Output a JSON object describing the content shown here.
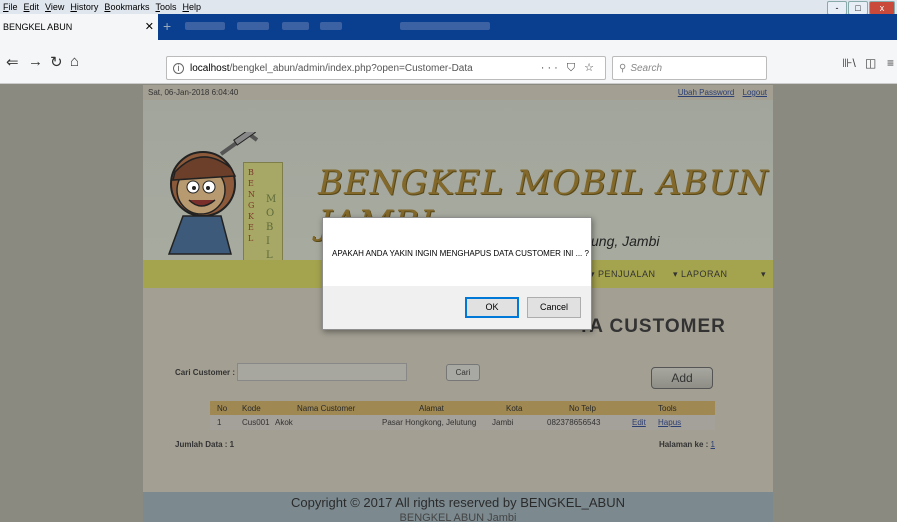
{
  "menubar": {
    "items": [
      "File",
      "Edit",
      "View",
      "History",
      "Bookmarks",
      "Tools",
      "Help"
    ],
    "window_controls": [
      "-",
      "□",
      "x"
    ]
  },
  "tab": {
    "title": "BENGKEL ABUN",
    "close": "✕",
    "new_tab": "+"
  },
  "nav": {
    "back": "⇐",
    "forward": "→",
    "reload": "↻",
    "home": "⌂"
  },
  "urlbar": {
    "host": "localhost",
    "path": "/bengkel_abun/admin/index.php?open=Customer-Data",
    "page_actions": "··· ⛉ ☆"
  },
  "searchbar": {
    "placeholder": "Search"
  },
  "toolbar_right": {
    "library": "⊪\\",
    "sidebar": "◫",
    "menu": "≡"
  },
  "site": {
    "datetime": "Sat, 06-Jan-2018 6:04:40",
    "links": {
      "change_password": "Ubah Password",
      "logout": "Logout"
    },
    "logo_card_text": "BENGKEL MOBIL ABUN",
    "title": "BENGKEL MOBIL ABUN JAMBI",
    "subtitle": "ung, Jambi",
    "menu": {
      "penjualan": "▾  PENJUALAN",
      "laporan": "▾  LAPORAN",
      "more": "▾"
    },
    "heading": "TA CUSTOMER",
    "search_label": "Cari Customer :",
    "cari_button": "Cari",
    "add_button": "Add",
    "table": {
      "headers": [
        "No",
        "Kode",
        "Nama Customer",
        "Alamat",
        "Kota",
        "No Telp",
        "Tools"
      ],
      "rows": [
        {
          "no": "1",
          "kode": "Cus001",
          "nama": "Akok",
          "alamat": "Pasar Hongkong, Jelutung",
          "kota": "Jambi",
          "telp": "082378656543",
          "edit": "Edit",
          "hapus": "Hapus"
        }
      ]
    },
    "jumlah": "Jumlah Data : 1",
    "halaman_label": "Halaman ke :",
    "halaman_page": "1",
    "footer_line1": "Copyright © 2017 All rights reserved by BENGKEL_ABUN",
    "footer_line2": "BENGKEL ABUN Jambi"
  },
  "dialog": {
    "message": "APAKAH ANDA YAKIN INGIN MENGHAPUS DATA CUSTOMER INI ... ?",
    "ok": "OK",
    "cancel": "Cancel"
  }
}
